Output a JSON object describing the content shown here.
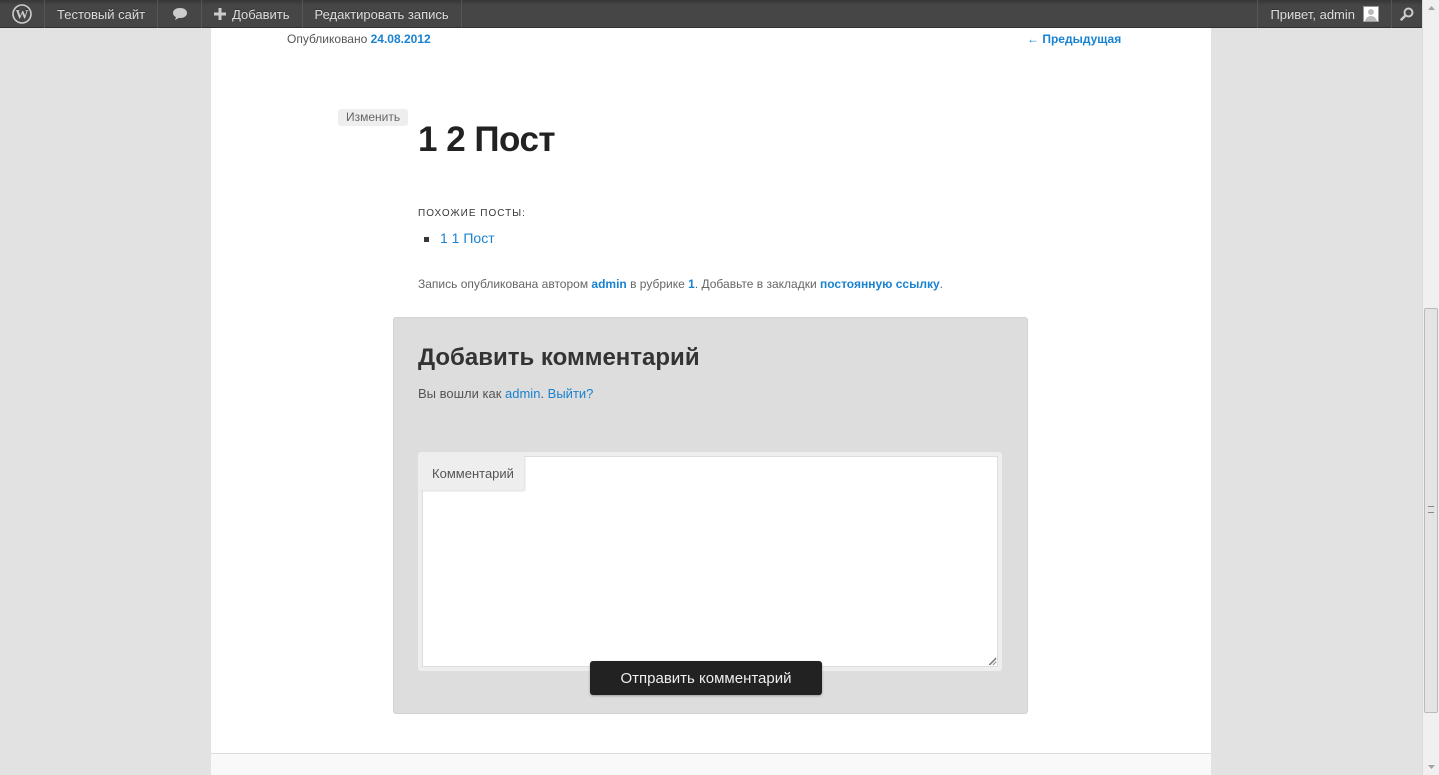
{
  "adminbar": {
    "site_name": "Тестовый сайт",
    "add_label": "Добавить",
    "edit_label": "Редактировать запись",
    "greeting": "Привет, admin"
  },
  "post": {
    "published_prefix": "Опубликовано",
    "published_date": "24.08.2012",
    "prev_link": "← Предыдущая",
    "edit_button": "Изменить",
    "title": "1 2 Пост",
    "related_heading": "Похожие посты:",
    "related_items": [
      "1 1 Пост"
    ],
    "meta": {
      "part1": "Запись опубликована автором ",
      "author": "admin",
      "part2": " в рубрике ",
      "category": "1",
      "part3": ". Добавьте в закладки ",
      "permalink": "постоянную ссылку",
      "part4": "."
    }
  },
  "comment_form": {
    "title": "Добавить комментарий",
    "logged_in_prefix": "Вы вошли как ",
    "user_link": "admin",
    "logout_link": "Выйти?",
    "field_label": "Комментарий",
    "textarea_value": "",
    "submit_label": "Отправить комментарий"
  },
  "colors": {
    "link": "#1982d1",
    "adminbar": "#464646",
    "submit_bg": "#222222"
  },
  "icons": {
    "logo": "wordpress-logo-icon",
    "comments": "comment-bubble-icon",
    "add": "plus-icon",
    "search": "search-icon"
  }
}
